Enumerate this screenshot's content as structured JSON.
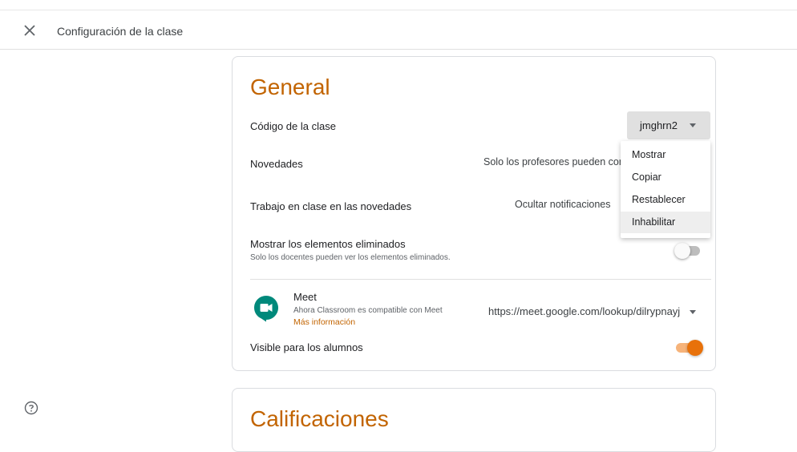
{
  "header": {
    "title": "Configuración de la clase"
  },
  "general": {
    "title": "General",
    "class_code": {
      "label": "Código de la clase",
      "value": "jmghrn2",
      "menu": [
        "Mostrar",
        "Copiar",
        "Restablecer",
        "Inhabilitar"
      ],
      "highlighted_item": "Inhabilitar"
    },
    "stream": {
      "label": "Novedades",
      "value": "Solo los profesores pueden con"
    },
    "classwork": {
      "label": "Trabajo en clase en las novedades",
      "value": "Ocultar notificaciones"
    },
    "deleted": {
      "label": "Mostrar los elementos eliminados",
      "sublabel": "Solo los docentes pueden ver los elementos eliminados.",
      "enabled": false
    },
    "meet": {
      "name": "Meet",
      "subtitle": "Ahora Classroom es compatible con Meet",
      "link": "Más información",
      "url": "https://meet.google.com/lookup/dilrypnayj",
      "visible_label": "Visible para los alumnos",
      "visible_enabled": true
    }
  },
  "grades": {
    "title": "Calificaciones"
  },
  "colors": {
    "accent": "#e8710a",
    "title": "#c26401"
  },
  "icons": {
    "close": "close-icon",
    "help": "help-icon",
    "meet": "meet-icon",
    "caret": "caret-down-icon"
  }
}
